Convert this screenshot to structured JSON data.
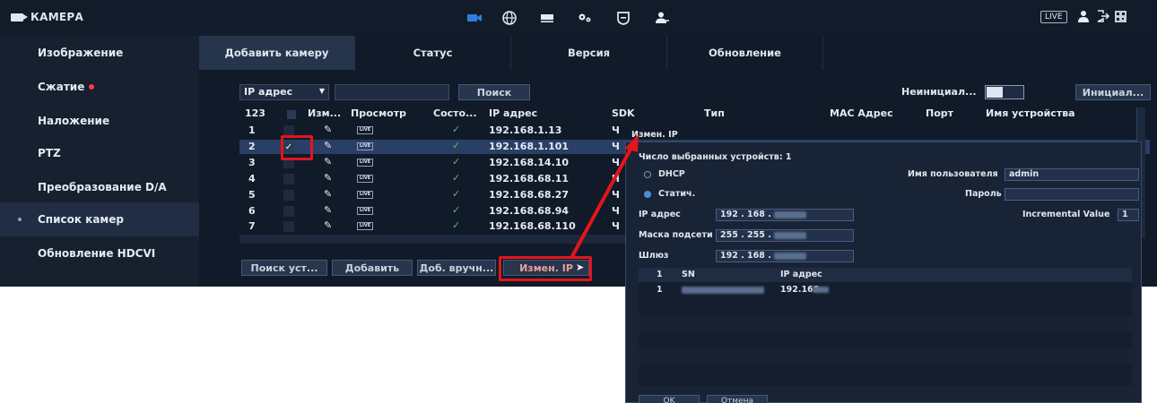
{
  "app": {
    "title": "КАМЕРА",
    "live_label": "LIVE"
  },
  "top_nav": [
    {
      "name": "camera-icon"
    },
    {
      "name": "network-icon"
    },
    {
      "name": "storage-icon"
    },
    {
      "name": "system-icon"
    },
    {
      "name": "security-icon"
    },
    {
      "name": "account-icon"
    }
  ],
  "sidebar": {
    "items": [
      {
        "label": "Изображение"
      },
      {
        "label": "Сжатие"
      },
      {
        "label": "Наложение"
      },
      {
        "label": "PTZ"
      },
      {
        "label": "Преобразование D/A"
      },
      {
        "label": "Список камер",
        "active": true
      },
      {
        "label": "Обновление HDCVI"
      }
    ]
  },
  "tabs": [
    {
      "label": "Добавить камеру",
      "active": true
    },
    {
      "label": "Статус"
    },
    {
      "label": "Версия"
    },
    {
      "label": "Обновление"
    }
  ],
  "toolbar": {
    "filter_value": "IP адрес",
    "search_value": "",
    "search_button": "Поиск",
    "uninit_label": "Неинициал...",
    "init_button": "Инициал..."
  },
  "table": {
    "columns": [
      "123",
      "Изм...",
      "Просмотр",
      "Состо...",
      "IP адрес",
      "SDK",
      "Тип",
      "MAC Адрес",
      "Порт",
      "Имя устройства"
    ],
    "rows": [
      {
        "num": "1",
        "ip": "192.168.1.13",
        "sdk": "Ч",
        "checked": false
      },
      {
        "num": "2",
        "ip": "192.168.1.101",
        "sdk": "Ч",
        "checked": true
      },
      {
        "num": "3",
        "ip": "192.168.14.10",
        "sdk": "Ч",
        "checked": false
      },
      {
        "num": "4",
        "ip": "192.168.68.11",
        "sdk": "Ч",
        "checked": false
      },
      {
        "num": "5",
        "ip": "192.168.68.27",
        "sdk": "Ч",
        "checked": false
      },
      {
        "num": "6",
        "ip": "192.168.68.94",
        "sdk": "Ч",
        "checked": false
      },
      {
        "num": "7",
        "ip": "192.168.68.110",
        "sdk": "Ч",
        "checked": false
      }
    ],
    "live_tag": "LIVE",
    "check_glyph": "✓",
    "check_mark": "✓",
    "pen_glyph": "✎"
  },
  "bottom_buttons": {
    "search_devices": "Поиск уст...",
    "add": "Добавить",
    "add_manual": "Доб. вручн...",
    "change_ip": "Измен. IP"
  },
  "modal": {
    "title_tab": "Измен. IP",
    "selected_count_label": "Число выбранных устройств: 1",
    "dhcp_label": "DHCP",
    "static_label": "Статич.",
    "username_label": "Имя пользователя",
    "username_value": "admin",
    "password_label": "Пароль",
    "ip_label": "IP адрес",
    "ip_value": "192 . 168 .",
    "mask_label": "Маска подсети",
    "mask_value": "255 . 255 .",
    "gateway_label": "Шлюз",
    "gateway_value": "192 . 168 .",
    "incremental_label": "Incremental Value",
    "incremental_value": "1",
    "list_headers": {
      "num": "1",
      "sn": "SN",
      "ip": "IP адрес"
    },
    "list_row": {
      "num": "1",
      "ip": "192.168"
    },
    "ok": "OK",
    "cancel": "Отмена"
  }
}
